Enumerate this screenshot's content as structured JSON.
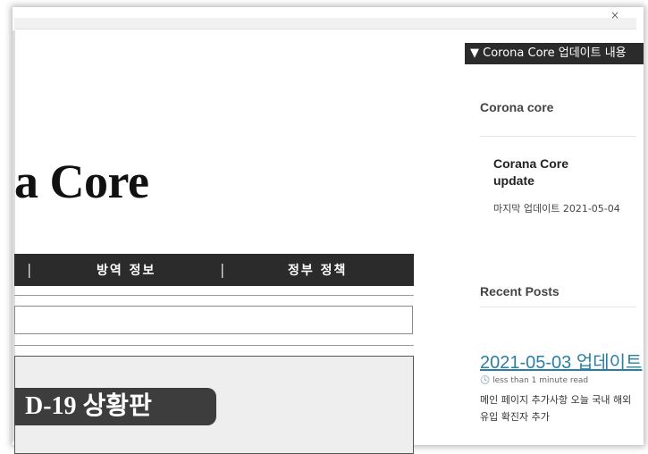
{
  "close_glyph": "×",
  "brand": {
    "title": "a Core"
  },
  "nav": {
    "separator": "|",
    "items": [
      "방역 정보",
      "정부 정책"
    ]
  },
  "board": {
    "title": "D-19 상황판"
  },
  "sidebar": {
    "toggle_label": "▼ Corona Core 업데이트 내용",
    "section_title": "Corona core",
    "core_card": {
      "title": "Corana Core update",
      "last_update": "마지막 업데이트 2021-05-04"
    },
    "recent_title": "Recent Posts",
    "posts": [
      {
        "title": "2021-05-03 업데이트",
        "read_time": "less than 1 minute read",
        "excerpt": "메인 페이지 추가사항 오늘 국내 해외 유입 확진자 추가"
      }
    ]
  }
}
